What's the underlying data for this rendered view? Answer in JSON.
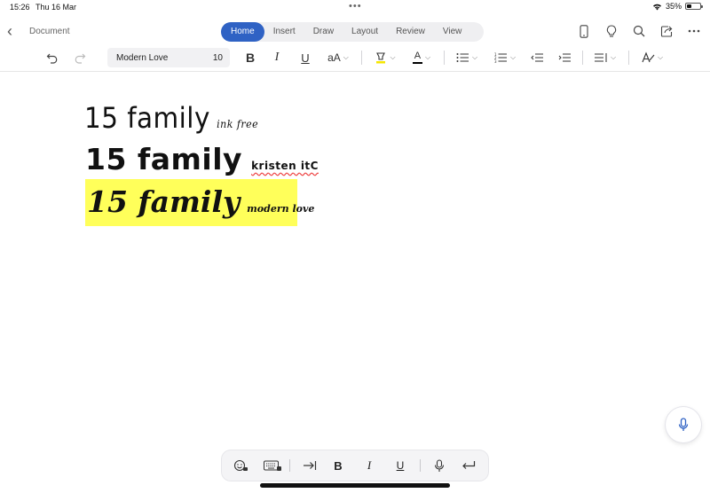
{
  "status_bar": {
    "time": "15:26",
    "date": "Thu 16 Mar",
    "battery": "35%",
    "battery_level": 0.35
  },
  "nav": {
    "document_title": "Document",
    "tabs": [
      {
        "label": "Home",
        "active": true
      },
      {
        "label": "Insert",
        "active": false
      },
      {
        "label": "Draw",
        "active": false
      },
      {
        "label": "Layout",
        "active": false
      },
      {
        "label": "Review",
        "active": false
      },
      {
        "label": "View",
        "active": false
      }
    ],
    "icons": [
      "phone-view-icon",
      "lightbulb-icon",
      "search-icon",
      "share-icon",
      "more-icon"
    ]
  },
  "toolbar": {
    "font_name": "Modern Love",
    "font_size": "10",
    "bold": "B",
    "italic": "I",
    "underline": "U",
    "text_size": "aA",
    "font_color": "A",
    "highlight_color": "#f5e600",
    "text_color": "#000000",
    "accent": "#2f62c4"
  },
  "document": {
    "lines": [
      {
        "big": "15 family",
        "small": "ink free"
      },
      {
        "big": "15 family",
        "small": "kristen itC"
      },
      {
        "big": "15 family",
        "small": "modern love",
        "highlight": "#ffff5a"
      }
    ]
  },
  "bottom_bar": {
    "bold": "B",
    "italic": "I",
    "underline": "U"
  }
}
